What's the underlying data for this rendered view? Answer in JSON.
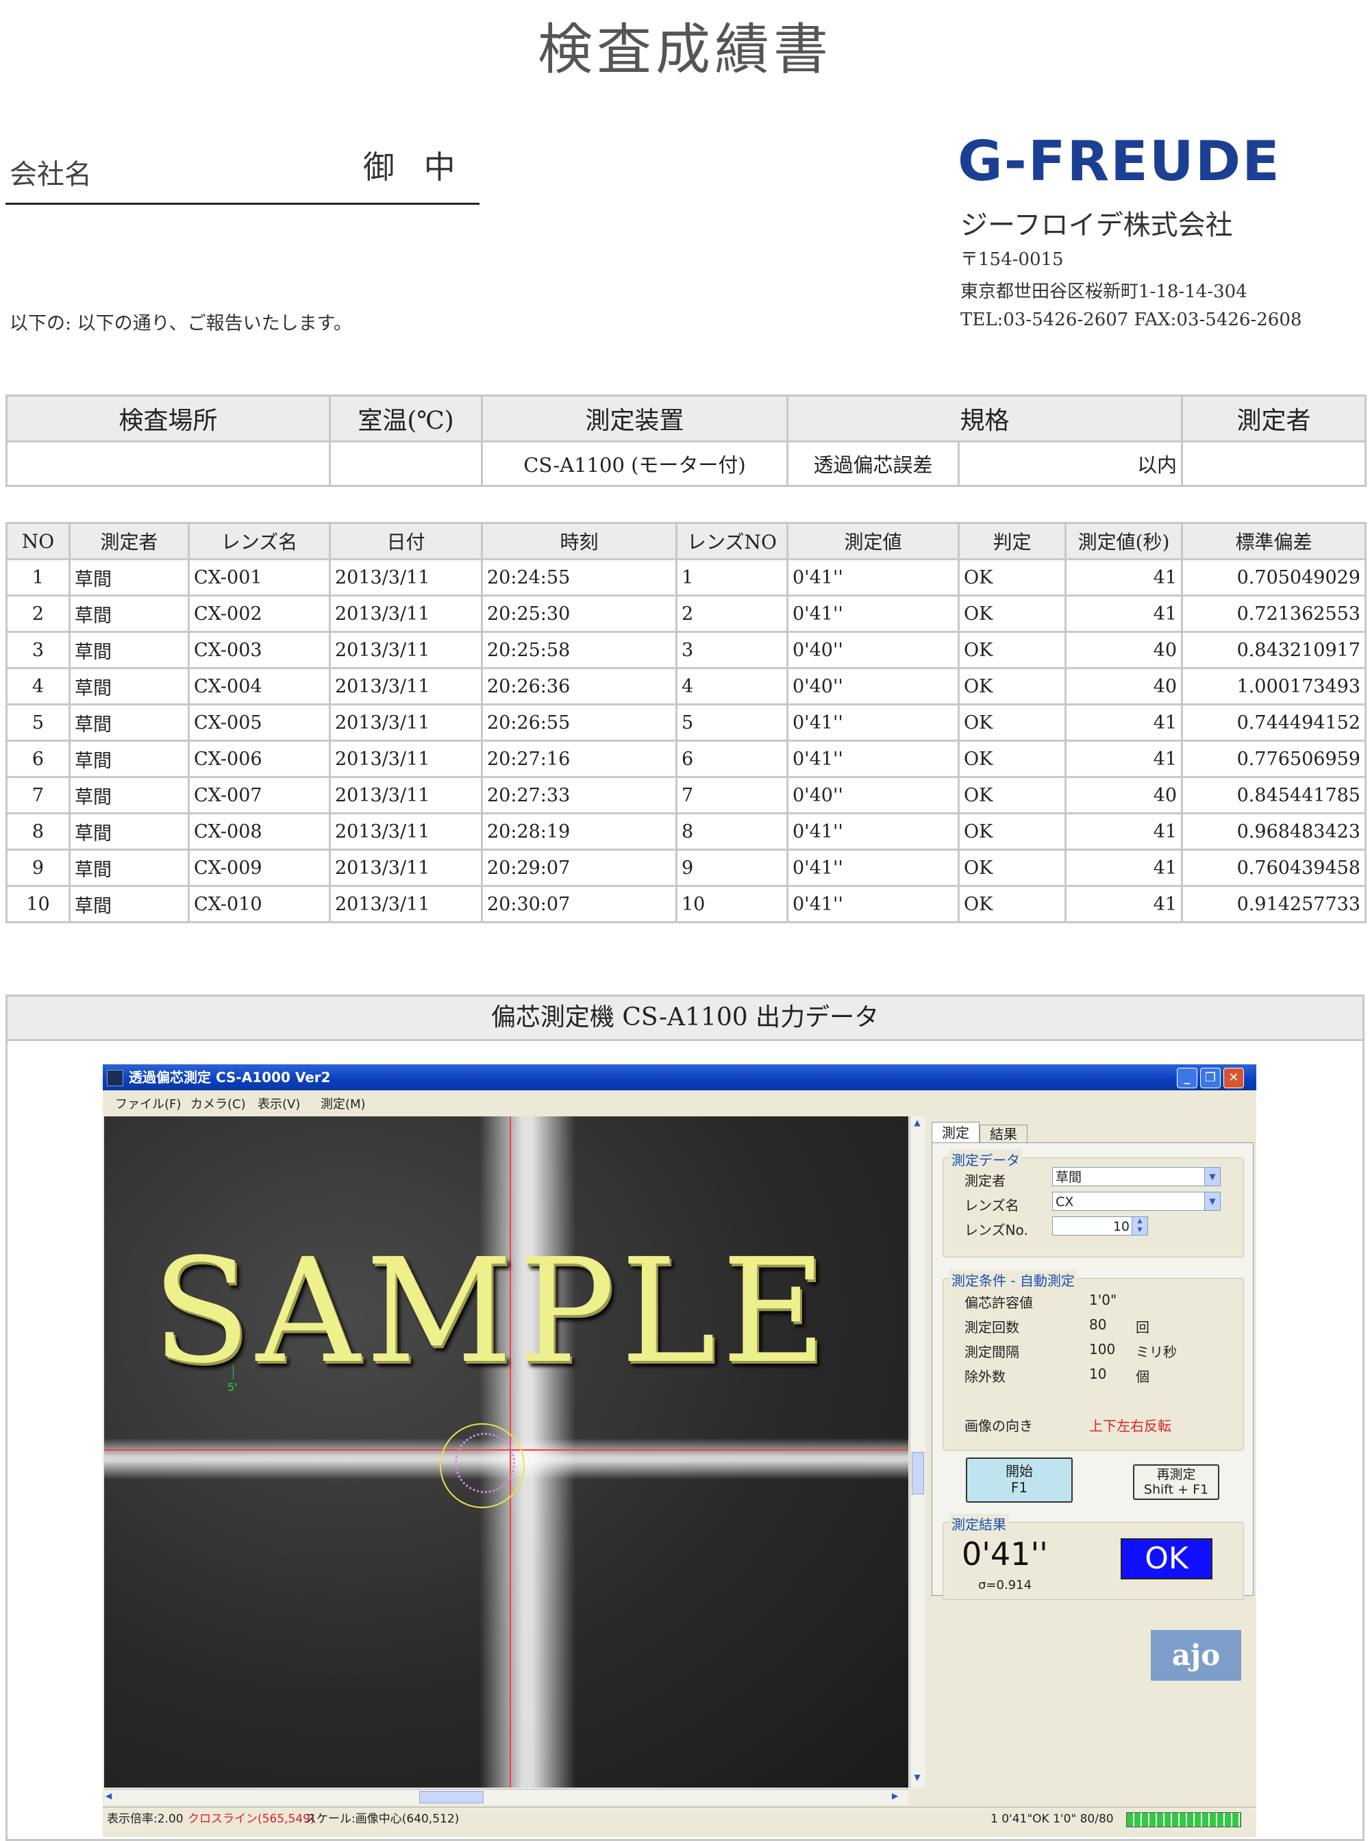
{
  "header": {
    "title": "検査成績書",
    "company_label": "会社名",
    "onchu": "御 中",
    "intro": "以下の: 以下の通り、ご報告いたします。"
  },
  "issuer": {
    "logo": "G-FREUDE",
    "name": "ジーフロイデ株式会社",
    "postal": "〒154-0015",
    "address": "東京都世田谷区桜新町1-18-14-304",
    "tel_fax": "TEL:03-5426-2607  FAX:03-5426-2608"
  },
  "info_table": {
    "headers": [
      "検査場所",
      "室温(℃)",
      "測定装置",
      "規格",
      "測定者"
    ],
    "location": "",
    "temperature": "",
    "device": "CS-A1100 (モーター付)",
    "spec_name": "透過偏芯誤差",
    "spec_value": "以内",
    "operator": ""
  },
  "measure_table": {
    "headers": [
      "NO",
      "測定者",
      "レンズ名",
      "日付",
      "時刻",
      "レンズNO",
      "測定値",
      "判定",
      "測定値(秒)",
      "標準偏差"
    ],
    "rows": [
      [
        "1",
        "草間",
        "CX-001",
        "2013/3/11",
        "20:24:55",
        "1",
        "0'41''",
        "OK",
        "41",
        "0.705049029"
      ],
      [
        "2",
        "草間",
        "CX-002",
        "2013/3/11",
        "20:25:30",
        "2",
        "0'41''",
        "OK",
        "41",
        "0.721362553"
      ],
      [
        "3",
        "草間",
        "CX-003",
        "2013/3/11",
        "20:25:58",
        "3",
        "0'40''",
        "OK",
        "40",
        "0.843210917"
      ],
      [
        "4",
        "草間",
        "CX-004",
        "2013/3/11",
        "20:26:36",
        "4",
        "0'40''",
        "OK",
        "40",
        "1.000173493"
      ],
      [
        "5",
        "草間",
        "CX-005",
        "2013/3/11",
        "20:26:55",
        "5",
        "0'41''",
        "OK",
        "41",
        "0.744494152"
      ],
      [
        "6",
        "草間",
        "CX-006",
        "2013/3/11",
        "20:27:16",
        "6",
        "0'41''",
        "OK",
        "41",
        "0.776506959"
      ],
      [
        "7",
        "草間",
        "CX-007",
        "2013/3/11",
        "20:27:33",
        "7",
        "0'40''",
        "OK",
        "40",
        "0.845441785"
      ],
      [
        "8",
        "草間",
        "CX-008",
        "2013/3/11",
        "20:28:19",
        "8",
        "0'41''",
        "OK",
        "41",
        "0.968483423"
      ],
      [
        "9",
        "草間",
        "CX-009",
        "2013/3/11",
        "20:29:07",
        "9",
        "0'41''",
        "OK",
        "41",
        "0.760439458"
      ],
      [
        "10",
        "草間",
        "CX-010",
        "2013/3/11",
        "20:30:07",
        "10",
        "0'41''",
        "OK",
        "41",
        "0.914257733"
      ]
    ]
  },
  "output_section": {
    "title": "偏芯測定機  CS-A1100  出力データ"
  },
  "app": {
    "window_title": "透過偏芯測定 CS-A1000 Ver2",
    "menu": [
      "ファイル(F)",
      "カメラ(C)",
      "表示(V)",
      "測定(M)"
    ],
    "watermark": "SAMPLE",
    "scale_label": "5'",
    "tabs": [
      "測定",
      "結果"
    ],
    "data_group": {
      "label": "測定データ",
      "operator_label": "測定者",
      "operator_value": "草間",
      "lens_label": "レンズ名",
      "lens_value": "CX",
      "lens_no_label": "レンズNo.",
      "lens_no_value": "10"
    },
    "cond_group": {
      "label": "測定条件 - 自動測定",
      "tolerance_label": "偏芯許容値",
      "tolerance_value": "1'0\"",
      "count_label": "測定回数",
      "count_value": "80",
      "count_unit": "回",
      "interval_label": "測定間隔",
      "interval_value": "100",
      "interval_unit": "ミリ秒",
      "exclude_label": "除外数",
      "exclude_value": "10",
      "exclude_unit": "個",
      "orientation_label": "画像の向き",
      "orientation_value": "上下左右反転"
    },
    "buttons": {
      "start": "開始",
      "start_key": "F1",
      "remeasure": "再測定",
      "remeasure_key": "Shift + F1"
    },
    "result_group": {
      "label": "測定結果",
      "value": "0'41''",
      "sigma": "σ=0.914",
      "judgement": "OK"
    },
    "logo": "ajo",
    "status": {
      "zoom": "表示倍率:2.00",
      "crossline": "クロスライン(565,549)",
      "scale": "スケール:画像中心(640,512)",
      "right": "1 0'41\"OK 1'0\"  80/80",
      "progress": 1.0
    },
    "colors": {
      "crosshair": "#ff3b3b",
      "ok_bg": "#1010ff",
      "accent_blue": "#1a4fb5",
      "orientation_red": "#e02020"
    }
  }
}
